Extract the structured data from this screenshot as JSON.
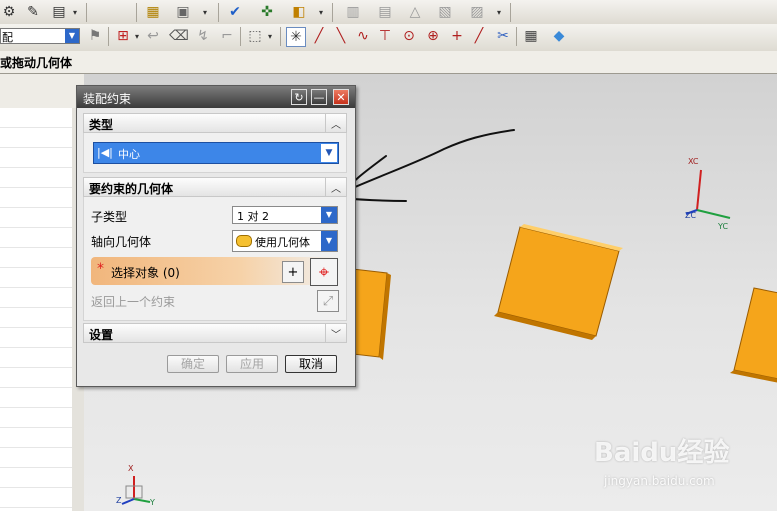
{
  "toolbar": {
    "assembly_combo_value": "配",
    "row1_icons": [
      "assembly-icon",
      "component-icon",
      "dropdown-icon",
      "document-icon",
      "clipboard-icon",
      "constraint-icon",
      "move-icon",
      "reposition-icon",
      "layer-icon",
      "sheet-icon",
      "triangle-icon",
      "paste-icon",
      "sketch-icon"
    ],
    "row2_icons": [
      "filter-icon",
      "select-box-icon",
      "undo-icon",
      "eraser-icon",
      "snap-icon",
      "grid-select-icon",
      "point-snap-icon",
      "line-icon",
      "arc-icon",
      "curve-icon",
      "intersection-icon",
      "circle-icon",
      "quadrant-icon",
      "plus-icon",
      "line-end-icon",
      "cut-icon",
      "matrix-icon",
      "cube-icon"
    ]
  },
  "cue_line": {
    "text": "或拖动几何体"
  },
  "dialog": {
    "title": "装配约束",
    "sections": {
      "type": {
        "label": "类型",
        "value": "中心"
      },
      "geometry": {
        "label": "要约束的几何体",
        "subtype_label": "子类型",
        "subtype_value": "1 对 2",
        "axial_label": "轴向几何体",
        "axial_value": "使用几何体",
        "select_label": "选择对象 (0)",
        "back_label": "返回上一个约束"
      },
      "settings": {
        "label": "设置"
      }
    },
    "buttons": {
      "ok": "确定",
      "apply": "应用",
      "cancel": "取消"
    }
  },
  "viewport": {
    "triad_top": {
      "x_label": "XC",
      "y_label": "YC",
      "z_label": "ZC"
    },
    "triad_bottom": {
      "x_label": "X",
      "y_label": "Y",
      "z_label": "Z"
    },
    "colors": {
      "block": "#f5a51b",
      "block_side": "#c07500",
      "axis_x": "#d02020",
      "axis_y": "#20a040",
      "axis_z": "#2040c0"
    }
  },
  "watermark": {
    "brand": "Baidu经验",
    "url": "jingyan.baidu.com"
  }
}
